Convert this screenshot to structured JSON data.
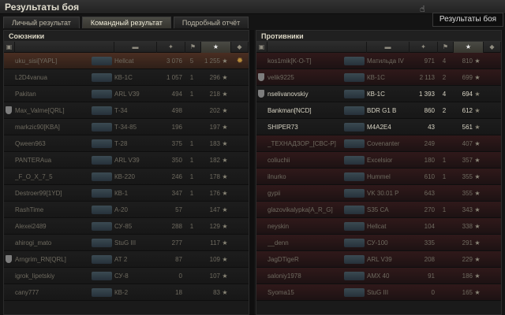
{
  "window": {
    "title": "Результаты боя",
    "tooltip": "Результаты боя"
  },
  "tabs": [
    {
      "label": "Личный результат",
      "active": false
    },
    {
      "label": "Командный результат",
      "active": true
    },
    {
      "label": "Подробный отчёт",
      "active": false
    }
  ],
  "allies": {
    "title": "Союзники",
    "rows": [
      {
        "player": "uku_sisi[YAPL]",
        "tank": "Hellcat",
        "damage": "3 076",
        "kills": "5",
        "xp": "1 255",
        "state": "dead",
        "highlight": true,
        "medal": true,
        "squad": false
      },
      {
        "player": "L2D4vanua",
        "tank": "КВ-1С",
        "damage": "1 057",
        "kills": "1",
        "xp": "296",
        "state": "dead",
        "highlight": false,
        "medal": false,
        "squad": false
      },
      {
        "player": "Pakitan",
        "tank": "ARL V39",
        "damage": "494",
        "kills": "1",
        "xp": "218",
        "state": "dead",
        "highlight": false,
        "medal": false,
        "squad": false
      },
      {
        "player": "Max_Valme[QRL]",
        "tank": "Т-34",
        "damage": "498",
        "kills": "",
        "xp": "202",
        "state": "dead",
        "highlight": false,
        "medal": false,
        "squad": true
      },
      {
        "player": "markzic90[KBA]",
        "tank": "Т-34-85",
        "damage": "196",
        "kills": "",
        "xp": "197",
        "state": "dead",
        "highlight": false,
        "medal": false,
        "squad": false
      },
      {
        "player": "Qween963",
        "tank": "Т-28",
        "damage": "375",
        "kills": "1",
        "xp": "183",
        "state": "dead",
        "highlight": false,
        "medal": false,
        "squad": false
      },
      {
        "player": "PANTERAua",
        "tank": "ARL V39",
        "damage": "350",
        "kills": "1",
        "xp": "182",
        "state": "dead",
        "highlight": false,
        "medal": false,
        "squad": false
      },
      {
        "player": "_F_O_X_7_5",
        "tank": "КВ-220",
        "damage": "246",
        "kills": "1",
        "xp": "178",
        "state": "dead",
        "highlight": false,
        "medal": false,
        "squad": false
      },
      {
        "player": "Destroer99[1YD]",
        "tank": "КВ-1",
        "damage": "347",
        "kills": "1",
        "xp": "176",
        "state": "dead",
        "highlight": false,
        "medal": false,
        "squad": false
      },
      {
        "player": "RashTime",
        "tank": "А-20",
        "damage": "57",
        "kills": "",
        "xp": "147",
        "state": "dead",
        "highlight": false,
        "medal": false,
        "squad": false
      },
      {
        "player": "Alexei2489",
        "tank": "СУ-85",
        "damage": "288",
        "kills": "1",
        "xp": "129",
        "state": "dead",
        "highlight": false,
        "medal": false,
        "squad": false
      },
      {
        "player": "ahirogi_mato",
        "tank": "StuG III",
        "damage": "277",
        "kills": "",
        "xp": "117",
        "state": "dead",
        "highlight": false,
        "medal": false,
        "squad": false
      },
      {
        "player": "Arngrim_RN[QRL]",
        "tank": "АТ 2",
        "damage": "87",
        "kills": "",
        "xp": "109",
        "state": "dead",
        "highlight": false,
        "medal": false,
        "squad": true
      },
      {
        "player": "igrok_lipetskiy",
        "tank": "СУ-8",
        "damage": "0",
        "kills": "",
        "xp": "107",
        "state": "dead",
        "highlight": false,
        "medal": false,
        "squad": false
      },
      {
        "player": "cany777",
        "tank": "КВ-2",
        "damage": "18",
        "kills": "",
        "xp": "83",
        "state": "dead",
        "highlight": false,
        "medal": false,
        "squad": false
      }
    ]
  },
  "enemies": {
    "title": "Противники",
    "rows": [
      {
        "player": "kos1mik[K-O-T]",
        "tank": "Матильда IV",
        "damage": "971",
        "kills": "4",
        "xp": "810",
        "state": "dead",
        "red": true,
        "squad": false
      },
      {
        "player": "velik9225",
        "tank": "КВ-1С",
        "damage": "2 113",
        "kills": "2",
        "xp": "699",
        "state": "dead",
        "red": true,
        "squad": true
      },
      {
        "player": "nselivanovskiy",
        "tank": "КВ-1С",
        "damage": "1 393",
        "kills": "4",
        "xp": "694",
        "state": "alive",
        "red": false,
        "squad": true
      },
      {
        "player": "Bankman[NCD]",
        "tank": "BDR G1 B",
        "damage": "860",
        "kills": "2",
        "xp": "612",
        "state": "alive",
        "red": false,
        "squad": false
      },
      {
        "player": "SHIPER73",
        "tank": "M4A2E4",
        "damage": "43",
        "kills": "",
        "xp": "561",
        "state": "alive",
        "red": false,
        "squad": false
      },
      {
        "player": "_ТЕХНАДЗОР_[CBC-P]",
        "tank": "Covenanter",
        "damage": "249",
        "kills": "",
        "xp": "407",
        "state": "dead",
        "red": true,
        "squad": false
      },
      {
        "player": "coliuchii",
        "tank": "Excelsior",
        "damage": "180",
        "kills": "1",
        "xp": "357",
        "state": "dead",
        "red": true,
        "squad": false
      },
      {
        "player": "ilnurko",
        "tank": "Hummel",
        "damage": "610",
        "kills": "1",
        "xp": "355",
        "state": "dead",
        "red": true,
        "squad": false
      },
      {
        "player": "gypii",
        "tank": "VK 30.01 P",
        "damage": "643",
        "kills": "",
        "xp": "355",
        "state": "dead",
        "red": true,
        "squad": false
      },
      {
        "player": "glazovikalypka[A_R_G]",
        "tank": "S35 CA",
        "damage": "270",
        "kills": "1",
        "xp": "343",
        "state": "dead",
        "red": true,
        "squad": false
      },
      {
        "player": "neyskin",
        "tank": "Hellcat",
        "damage": "104",
        "kills": "",
        "xp": "338",
        "state": "dead",
        "red": true,
        "squad": false
      },
      {
        "player": "__denn",
        "tank": "СУ-100",
        "damage": "335",
        "kills": "",
        "xp": "291",
        "state": "dead",
        "red": true,
        "squad": false
      },
      {
        "player": "JagDTigeR",
        "tank": "ARL V39",
        "damage": "208",
        "kills": "",
        "xp": "229",
        "state": "dead",
        "red": true,
        "squad": false
      },
      {
        "player": "saloniy1978",
        "tank": "AMX 40",
        "damage": "91",
        "kills": "",
        "xp": "186",
        "state": "dead",
        "red": true,
        "squad": false
      },
      {
        "player": "Syoma15",
        "tank": "StuG III",
        "damage": "0",
        "kills": "",
        "xp": "165",
        "state": "dead",
        "red": true,
        "squad": false
      }
    ]
  },
  "icons": {
    "star": "★",
    "medal": "✹",
    "sort": "▾"
  },
  "colors": {
    "highlight": "#4a2e22",
    "enemy_dead": "#30191a",
    "text_alive": "#d8d4c4"
  }
}
